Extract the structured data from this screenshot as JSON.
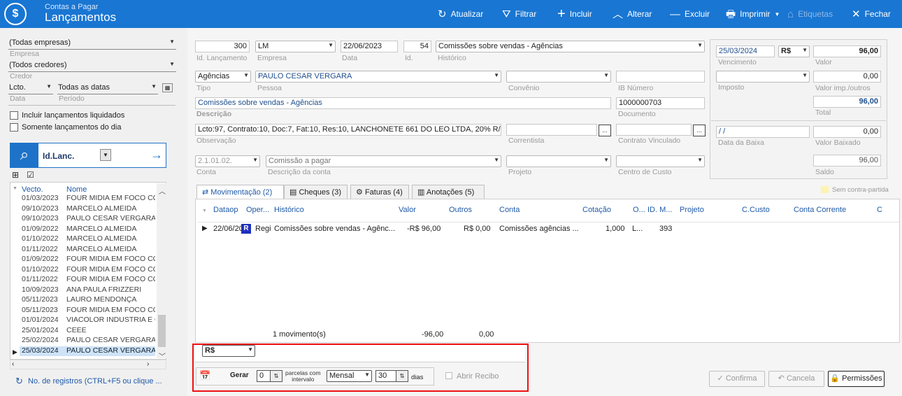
{
  "app": {
    "subtitle": "Contas a Pagar",
    "title": "Lançamentos",
    "logo": "$"
  },
  "toolbar": [
    {
      "label": "Atualizar",
      "icon": "refresh-icon",
      "glyph": "↻",
      "enabled": true
    },
    {
      "label": "Filtrar",
      "icon": "filter-icon",
      "glyph": "⛛",
      "enabled": true
    },
    {
      "label": "Incluir",
      "icon": "plus-icon",
      "glyph": "+",
      "enabled": true
    },
    {
      "label": "Alterar",
      "icon": "chevron-up-icon",
      "glyph": "︿",
      "enabled": true
    },
    {
      "label": "Excluir",
      "icon": "minus-icon",
      "glyph": "—",
      "enabled": true
    },
    {
      "label": "Imprimir",
      "icon": "printer-icon",
      "glyph": "🖶",
      "enabled": true
    },
    {
      "label": "Etiquetas",
      "icon": "tag-icon",
      "glyph": "⌂",
      "enabled": false
    },
    {
      "label": "Fechar",
      "icon": "close-icon",
      "glyph": "✕",
      "enabled": true
    }
  ],
  "sidebar": {
    "empresa": {
      "value": "(Todas empresas)",
      "label": "Empresa"
    },
    "credor": {
      "value": "(Todos credores)",
      "label": "Credor"
    },
    "data": {
      "value": "Lcto.",
      "label": "Data"
    },
    "periodo": {
      "value": "Todas as datas",
      "label": "Período"
    },
    "incluir_liquidados": "Incluir lançamentos liquidados",
    "somente_dia": "Somente lançamentos do dia",
    "search": {
      "value": "Id.Lanc."
    },
    "grid_headers": {
      "vecto": "Vecto.",
      "nome": "Nome"
    },
    "rows": [
      {
        "date": "01/03/2023",
        "name": "FOUR MIDIA EM FOCO CO"
      },
      {
        "date": "09/10/2023",
        "name": "MARCELO ALMEIDA"
      },
      {
        "date": "09/10/2023",
        "name": "PAULO CESAR VERGARA"
      },
      {
        "date": "01/09/2022",
        "name": "MARCELO ALMEIDA"
      },
      {
        "date": "01/10/2022",
        "name": "MARCELO ALMEIDA"
      },
      {
        "date": "01/11/2022",
        "name": "MARCELO ALMEIDA"
      },
      {
        "date": "01/09/2022",
        "name": "FOUR MIDIA EM FOCO CO"
      },
      {
        "date": "01/10/2022",
        "name": "FOUR MIDIA EM FOCO CO"
      },
      {
        "date": "01/11/2022",
        "name": "FOUR MIDIA EM FOCO CO"
      },
      {
        "date": "10/09/2023",
        "name": "ANA PAULA FRIZZERI"
      },
      {
        "date": "05/11/2023",
        "name": "LAURO MENDONÇA"
      },
      {
        "date": "05/11/2023",
        "name": "FOUR MIDIA EM FOCO CO"
      },
      {
        "date": "01/01/2024",
        "name": "VIACOLOR INDUSTRIA E C"
      },
      {
        "date": "25/01/2024",
        "name": "CEEE"
      },
      {
        "date": "25/02/2024",
        "name": "PAULO CESAR VERGARA"
      },
      {
        "date": "25/03/2024",
        "name": "PAULO CESAR VERGARA",
        "selected": true
      }
    ],
    "footer": "No. de registros (CTRL+F5 ou clique ..."
  },
  "form": {
    "id_lancamento": {
      "value": "300",
      "label": "Id. Lançamento"
    },
    "empresa": {
      "value": "LM",
      "label": "Empresa"
    },
    "data": {
      "value": "22/06/2023",
      "label": "Data"
    },
    "id": {
      "value": "54",
      "label": "Id."
    },
    "historico": {
      "value": "Comissões sobre vendas - Agências",
      "label": "Histórico"
    },
    "tipo": {
      "value": "Agências",
      "label": "Tipo"
    },
    "pessoa": {
      "value": "PAULO CESAR VERGARA",
      "label": "Pessoa"
    },
    "convenio": {
      "value": "",
      "label": "Convênio"
    },
    "ib_numero": {
      "value": "",
      "label": "IB Número"
    },
    "descricao": {
      "value": "Comissões sobre vendas - Agências",
      "label": "Descrição"
    },
    "documento": {
      "value": "1000000703",
      "label": "Documento"
    },
    "observacao": {
      "value": "Lcto:97, Contrato:10, Doc:7, Fat:10, Res:10, LANCHONETE 661 DO LEO LTDA, 20% R/0/",
      "label": "Observação"
    },
    "correntista": {
      "value": "",
      "label": "Correntista"
    },
    "contrato_vinculado": {
      "value": "",
      "label": "Contrato Vinculado"
    },
    "conta": {
      "value": "2.1.01.02.",
      "label": "Conta"
    },
    "descricao_conta": {
      "value": "Comissão a pagar",
      "label": "Descrição da conta"
    },
    "projeto": {
      "value": "",
      "label": "Projeto"
    },
    "centro_custo": {
      "value": "",
      "label": "Centro de Custo"
    },
    "ellipsis": "..."
  },
  "summary": {
    "vencimento": {
      "value": "25/03/2024",
      "label": "Vencimento"
    },
    "moeda": "R$",
    "valor": {
      "value": "96,00",
      "label": "Valor"
    },
    "imposto": {
      "value": "",
      "label": "Imposto"
    },
    "valor_imp": {
      "value": "0,00",
      "label": "Valor imp./outros"
    },
    "total": {
      "value": "96,00",
      "label": "Total"
    },
    "data_baixa": {
      "value": "/ /",
      "label": "Data da Baixa"
    },
    "valor_baixado": {
      "value": "0,00",
      "label": "Valor Baixado"
    },
    "saldo": {
      "value": "96,00",
      "label": "Saldo"
    }
  },
  "tabs": [
    {
      "label": "Movimentação (2)",
      "icon": "exchange-icon",
      "glyph": "⇄",
      "active": true
    },
    {
      "label": "Cheques (3)",
      "icon": "cheque-icon",
      "glyph": "▤",
      "active": false
    },
    {
      "label": "Faturas (4)",
      "icon": "invoice-icon",
      "glyph": "⚙",
      "active": false
    },
    {
      "label": "Anotações (5)",
      "icon": "notes-icon",
      "glyph": "▥",
      "active": false
    }
  ],
  "legend": {
    "label": "Sem contra-partida",
    "color": "#fff3b0"
  },
  "movements": {
    "headers": {
      "dataop": "Dataop",
      "oper": "Oper...",
      "historico": "Histórico",
      "valor": "Valor",
      "outros": "Outros",
      "conta": "Conta",
      "cotacao": "Cotação",
      "o": "O...",
      "id_m": "ID. M...",
      "projeto": "Projeto",
      "ccusto": "C.Custo",
      "conta_corrente": "Conta Corrente",
      "c": "C"
    },
    "row": {
      "dataop": "22/06/20",
      "oper_badge": "R",
      "oper": "Regi",
      "historico": "Comissões sobre vendas - Agênc...",
      "valor": "-R$ 96,00",
      "outros": "R$ 0,00",
      "conta": "Comissões agências ...",
      "cotacao": "1,000",
      "o": "L...",
      "id_m": "393"
    },
    "footer": {
      "count": "1 movimento(s)",
      "valor": "-96,00",
      "outros": "0,00"
    }
  },
  "bottom": {
    "moeda": "R$",
    "gerar_label": "Gerar",
    "parcelas": "0",
    "parcelas_com": "parcelas com",
    "intervalo": "intervalo",
    "periodicidade": "Mensal",
    "dias_valor": "30",
    "dias_label": "dias",
    "abrir_recibo": "Abrir Recibo"
  },
  "actions": {
    "confirmar": "Confirma",
    "cancelar": "Cancela",
    "permissoes": "Permissões"
  }
}
